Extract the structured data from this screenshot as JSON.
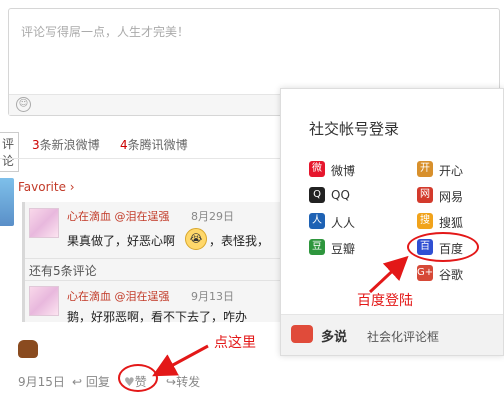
{
  "comment_box": {
    "placeholder": "评论写得屌一点，人生才完美！"
  },
  "tabs": {
    "comments_label": "评论",
    "sina": {
      "count": "3",
      "label": "条新浪微博"
    },
    "tencent": {
      "count": "4",
      "label": "条腾讯微博"
    }
  },
  "post": {
    "author": "Favorite",
    "replies": [
      {
        "author": "心在滴血 @泪在逞强",
        "date": "8月29日",
        "text_before": "果真做了，好恶心啊",
        "text_after": "，表怪我，",
        "emoji": "sad-crying-emoji"
      },
      {
        "author": "心在滴血 @泪在逞强",
        "date": "9月13日",
        "text": "鹅，好邪恶啊，看不下去了，咋办"
      }
    ],
    "more_label": "还有5条评论",
    "date": "9月15日",
    "actions": {
      "reply": "回复",
      "like": "赞",
      "forward": "转发"
    }
  },
  "login_panel": {
    "title": "社交帐号登录",
    "providers": [
      {
        "label": "微博",
        "icon": "weibo-icon",
        "color": "#e6162d"
      },
      {
        "label": "开心",
        "icon": "kaixin-icon",
        "color": "#d8902c"
      },
      {
        "label": "QQ",
        "icon": "qq-icon",
        "color": "#222222"
      },
      {
        "label": "网易",
        "icon": "netease-icon",
        "color": "#d33a2c"
      },
      {
        "label": "人人",
        "icon": "renren-icon",
        "color": "#1e62b4"
      },
      {
        "label": "搜狐",
        "icon": "sohu-icon",
        "color": "#f1a31b"
      },
      {
        "label": "豆瓣",
        "icon": "douban-icon",
        "color": "#2e963d"
      },
      {
        "label": "百度",
        "icon": "baidu-icon",
        "color": "#2f4fd3"
      },
      {
        "label": "谷歌",
        "icon": "google-icon",
        "color": "#d64937"
      }
    ],
    "footer": {
      "brand": "多说",
      "desc": "社会化评论框"
    }
  },
  "annotations": {
    "baidu_login": "百度登陆",
    "click_here": "点这里"
  }
}
